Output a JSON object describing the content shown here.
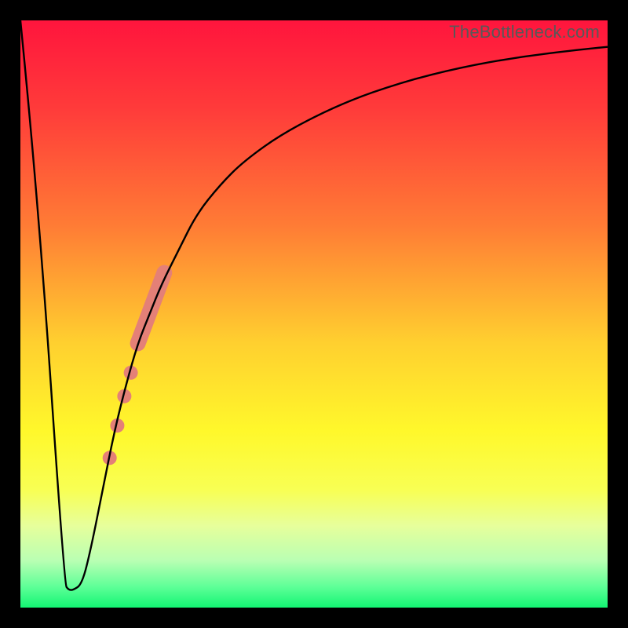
{
  "watermark": "TheBottleneck.com",
  "colors": {
    "frame": "#000000",
    "curve": "#000000",
    "marker_fill": "#e48077",
    "gradient_stops": [
      {
        "offset": 0.0,
        "color": "#ff153d"
      },
      {
        "offset": 0.15,
        "color": "#ff3b3a"
      },
      {
        "offset": 0.35,
        "color": "#ff7c35"
      },
      {
        "offset": 0.55,
        "color": "#ffd02f"
      },
      {
        "offset": 0.7,
        "color": "#fff82b"
      },
      {
        "offset": 0.8,
        "color": "#f8ff54"
      },
      {
        "offset": 0.86,
        "color": "#e7ff9b"
      },
      {
        "offset": 0.92,
        "color": "#b9ffb3"
      },
      {
        "offset": 0.965,
        "color": "#5dff97"
      },
      {
        "offset": 1.0,
        "color": "#13f573"
      }
    ]
  },
  "chart_data": {
    "type": "line",
    "title": "",
    "xlabel": "",
    "ylabel": "",
    "xlim": [
      0,
      100
    ],
    "ylim": [
      0,
      100
    ],
    "grid": false,
    "legend": false,
    "series": [
      {
        "name": "bottleneck-curve",
        "x": [
          0,
          3,
          7.5,
          8.2,
          9.0,
          10.5,
          12,
          14,
          16,
          18,
          20,
          22,
          24,
          27,
          30,
          34,
          38,
          45,
          55,
          65,
          75,
          85,
          95,
          100
        ],
        "y": [
          100,
          70,
          4,
          3,
          3,
          4,
          10,
          20,
          30,
          38,
          45,
          50,
          55,
          61,
          67,
          72,
          76,
          81,
          86,
          89.5,
          92,
          93.8,
          95,
          95.5
        ]
      }
    ],
    "markers": [
      {
        "shape": "thick-segment",
        "x0": 20.0,
        "y0": 45.0,
        "x1": 24.5,
        "y1": 57.0,
        "width": 20
      },
      {
        "shape": "dot",
        "x": 18.8,
        "y": 40.0,
        "r": 9
      },
      {
        "shape": "dot",
        "x": 17.7,
        "y": 36.0,
        "r": 9
      },
      {
        "shape": "dot",
        "x": 16.5,
        "y": 31.0,
        "r": 9
      },
      {
        "shape": "dot",
        "x": 15.2,
        "y": 25.5,
        "r": 9
      }
    ]
  }
}
